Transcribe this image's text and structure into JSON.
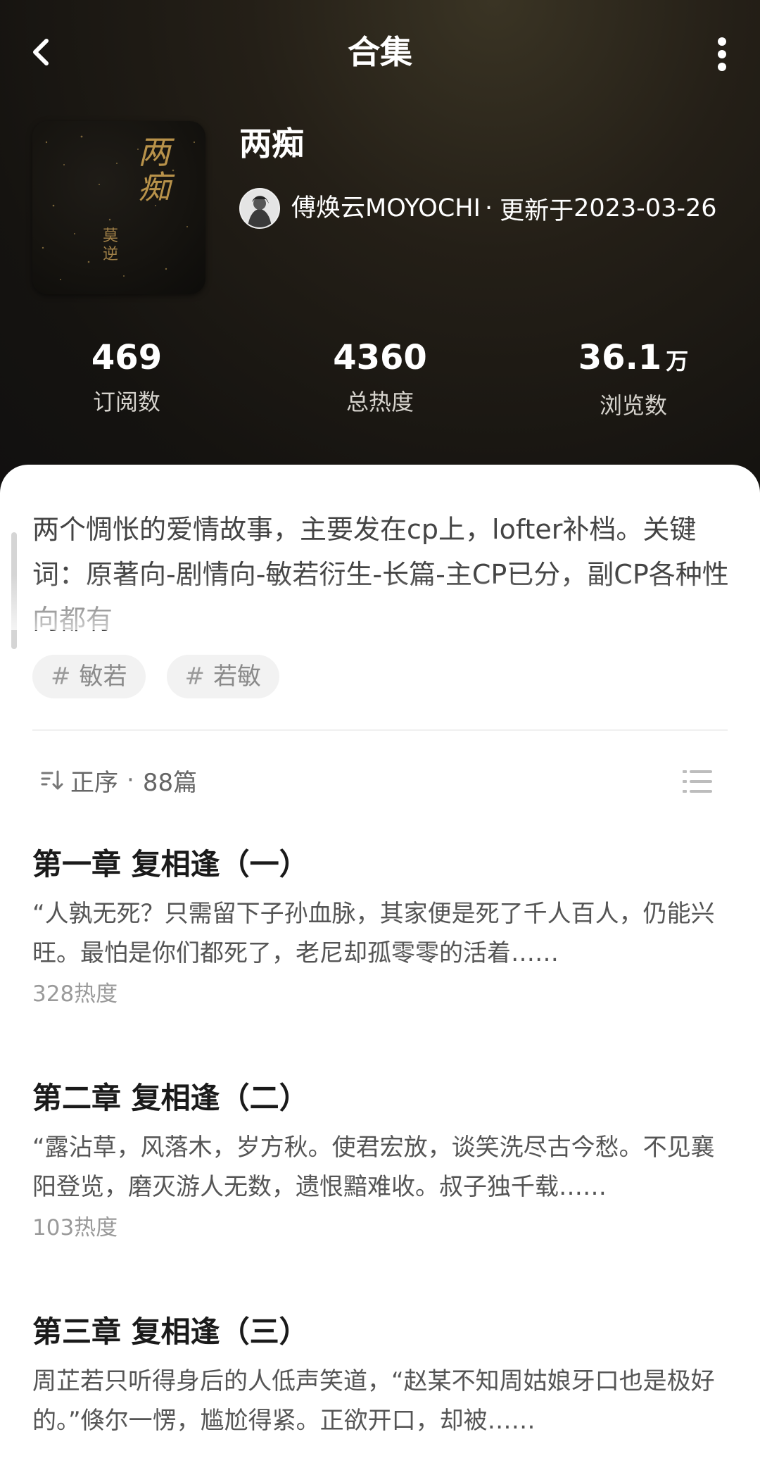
{
  "topbar": {
    "title": "合集"
  },
  "collection": {
    "title": "两痴",
    "author": "傅焕云MOYOCHI",
    "update_label": "更新于",
    "update_date": "2023-03-26",
    "cover_text": [
      "两",
      "痴"
    ],
    "cover_small_text": "莫逆"
  },
  "stats": [
    {
      "value": "469",
      "unit": "",
      "label": "订阅数"
    },
    {
      "value": "4360",
      "unit": "",
      "label": "总热度"
    },
    {
      "value": "36.1",
      "unit": "万",
      "label": "浏览数"
    }
  ],
  "description": "两个惆怅的爱情故事，主要发在cp上，lofter补档。关键词：原著向-剧情向-敏若衍生-长篇-主CP已分，副CP各种性向都有",
  "tags": [
    "敏若",
    "若敏"
  ],
  "sort": {
    "label": "正序",
    "separator": "·",
    "count": "88篇"
  },
  "chapters": [
    {
      "title": "第一章 复相逢（一）",
      "excerpt": "“人孰无死？只需留下子孙血脉，其家便是死了千人百人，仍能兴旺。最怕是你们都死了，老尼却孤零零的活着……",
      "heat": "328热度"
    },
    {
      "title": "第二章 复相逢（二）",
      "excerpt": "“露沾草，风落木，岁方秋。使君宏放，谈笑洗尽古今愁。不见襄阳登览，磨灭游人无数，遗恨黯难收。叔子独千载……",
      "heat": "103热度"
    },
    {
      "title": "第三章 复相逢（三）",
      "excerpt": "周芷若只听得身后的人低声笑道，“赵某不知周姑娘牙口也是极好的。”倏尔一愣，尴尬得紧。正欲开口，却被……",
      "heat": ""
    }
  ],
  "colors": {
    "header_dark": "#151310",
    "accent_gold": "#8a6a2e"
  },
  "icons": [
    "back-arrow-icon",
    "more-vertical-icon",
    "sort-ascending-icon",
    "list-icon"
  ]
}
